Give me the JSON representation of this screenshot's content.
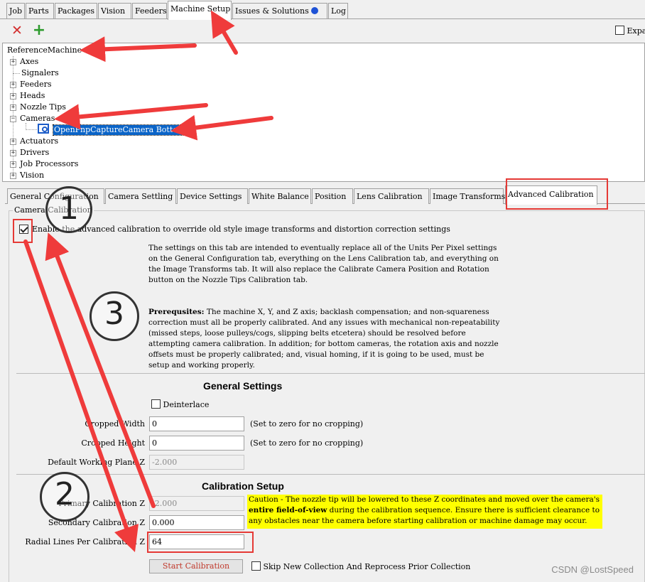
{
  "main_tabs": [
    "Job",
    "Parts",
    "Packages",
    "Vision",
    "Feeders",
    "Machine Setup",
    "Issues & Solutions",
    "Log"
  ],
  "toolbar": {
    "delete_icon": "x-icon",
    "add_icon": "plus-icon",
    "expand_label": "Expa"
  },
  "tree": {
    "root": "ReferenceMachine",
    "items": [
      "Axes",
      "Signalers",
      "Feeders",
      "Heads",
      "Nozzle Tips",
      "Cameras",
      "Actuators",
      "Drivers",
      "Job Processors",
      "Vision"
    ],
    "camera_child": "OpenPnpCaptureCamera Bottom"
  },
  "sub_tabs": [
    "General Configuration",
    "Camera Settling",
    "Device Settings",
    "White Balance",
    "Position",
    "Lens Calibration",
    "Image Transforms",
    "Advanced Calibration"
  ],
  "calibration": {
    "group_title": "Camera Calibration",
    "enable_label": "Enable the advanced calibration to override old style image transforms and distortion correction settings",
    "intro": "The settings on this tab are intended to eventually replace all of the Units Per Pixel settings on the General Configuration tab, everything on the Lens Calibration tab, and everything on the Image Transforms tab. It will also replace the Calibrate Camera Position and Rotation button on the Nozzle Tips Calibration tab.",
    "prereq_label": "Prerequsites:",
    "prereq_text": " The machine X, Y, and Z axis; backlash compensation; and non-squareness correction must all be properly calibrated. And any issues with mechanical non-repeatability (missed steps, loose pulleys/cogs, slipping belts etcetera) should be resolved before attempting camera calibration. In addition; for bottom cameras, the rotation axis and nozzle offsets must be properly calibrated; and, visual homing, if it is going to be used, must be setup and working properly."
  },
  "general_settings": {
    "title": "General Settings",
    "deinterlace_label": "Deinterlace",
    "cropped_width_label": "Cropped Width",
    "cropped_width_value": "0",
    "cropped_width_hint": "(Set to zero for no cropping)",
    "cropped_height_label": "Cropped Height",
    "cropped_height_value": "0",
    "cropped_height_hint": "(Set to zero for no cropping)",
    "working_plane_label": "Default Working Plane Z",
    "working_plane_value": "-2.000"
  },
  "calibration_setup": {
    "title": "Calibration Setup",
    "primary_label": "Primary Calibration Z",
    "primary_value": "-2.000",
    "secondary_label": "Secondary Calibration Z",
    "secondary_value": "0.000",
    "radial_label": "Radial Lines Per Calibration Z",
    "radial_value": "64",
    "caution_prefix": "Caution - The nozzle tip will be lowered to these Z coordinates and moved over the camera's ",
    "caution_bold": "entire field-of-view",
    "caution_suffix": " during the calibration sequence. Ensure there is sufficient clearance to any obstacles near the camera before starting calibration or machine damage may occur.",
    "start_button": "Start Calibration",
    "skip_label": "Skip New Collection And Reprocess Prior Collection"
  },
  "annotations": {
    "circle_1": "1",
    "circle_2": "2",
    "circle_3": "3",
    "arrow_color": "#ef3b3b"
  },
  "watermark": "CSDN @LostSpeed"
}
